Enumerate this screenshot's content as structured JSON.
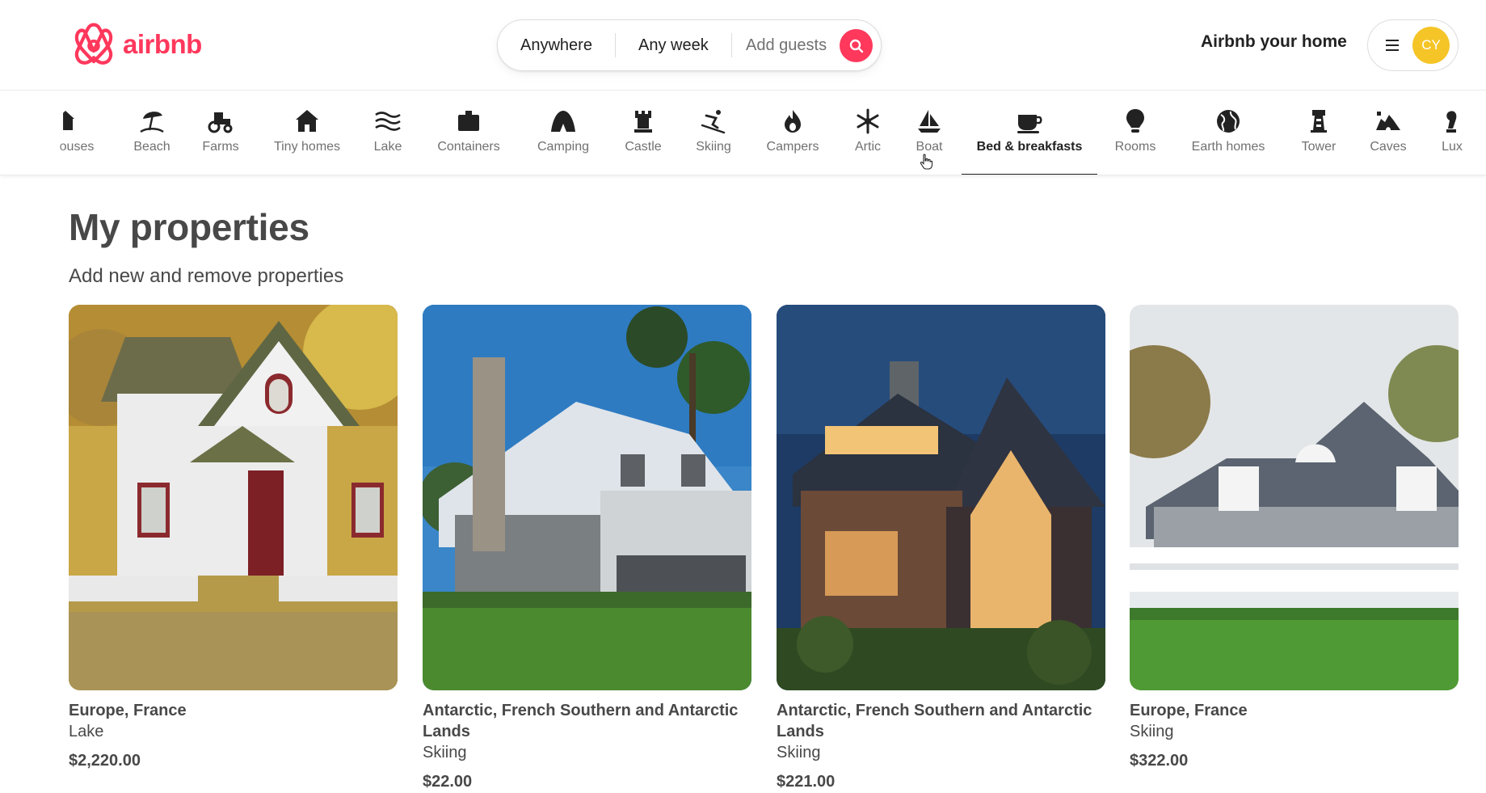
{
  "brand": {
    "name": "airbnb",
    "color": "#ff385c"
  },
  "search": {
    "anywhere": "Anywhere",
    "any_week": "Any week",
    "add_guests": "Add guests"
  },
  "header": {
    "host_link": "Airbnb your home",
    "avatar_initials": "CY"
  },
  "categories": {
    "items": [
      {
        "label": "ouses",
        "icon": "house-icon"
      },
      {
        "label": "Beach",
        "icon": "beach-umbrella-icon"
      },
      {
        "label": "Farms",
        "icon": "tractor-icon"
      },
      {
        "label": "Tiny homes",
        "icon": "tiny-home-icon"
      },
      {
        "label": "Lake",
        "icon": "lake-waves-icon"
      },
      {
        "label": "Containers",
        "icon": "container-icon"
      },
      {
        "label": "Camping",
        "icon": "tent-icon"
      },
      {
        "label": "Castle",
        "icon": "castle-icon"
      },
      {
        "label": "Skiing",
        "icon": "skier-icon"
      },
      {
        "label": "Campers",
        "icon": "campfire-icon"
      },
      {
        "label": "Artic",
        "icon": "snowflake-icon"
      },
      {
        "label": "Boat",
        "icon": "sailboat-icon"
      },
      {
        "label": "Bed & breakfasts",
        "icon": "coffee-cup-icon",
        "active": true
      },
      {
        "label": "Rooms",
        "icon": "lightbulb-icon"
      },
      {
        "label": "Earth homes",
        "icon": "globe-icon"
      },
      {
        "label": "Tower",
        "icon": "tower-icon"
      },
      {
        "label": "Caves",
        "icon": "cave-icon"
      },
      {
        "label": "Lux",
        "icon": "luxe-icon"
      }
    ]
  },
  "page": {
    "title": "My properties",
    "subtitle": "Add new and remove properties"
  },
  "properties": [
    {
      "location": "Europe, France",
      "category": "Lake",
      "price": "$2,220.00"
    },
    {
      "location": "Antarctic, French Southern and Antarctic Lands",
      "category": "Skiing",
      "price": "$22.00"
    },
    {
      "location": "Antarctic, French Southern and Antarctic Lands",
      "category": "Skiing",
      "price": "$221.00"
    },
    {
      "location": "Europe, France",
      "category": "Skiing",
      "price": "$322.00"
    }
  ]
}
